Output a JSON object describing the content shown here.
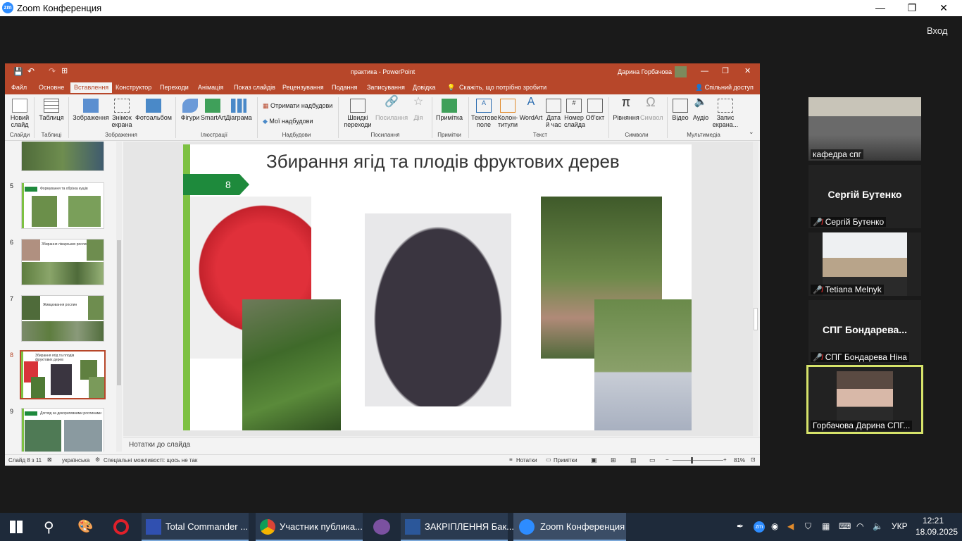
{
  "zoom": {
    "title": "Zoom Конференция",
    "logo": "zm",
    "exit_label": "Вход",
    "min": "—",
    "max": "❐",
    "close": "✕"
  },
  "ppt": {
    "title": "практика  -  PowerPoint",
    "user": "Дарина Горбачова",
    "tabs": [
      "Файл",
      "Основне",
      "Вставлення",
      "Конструктор",
      "Переходи",
      "Анімація",
      "Показ слайдів",
      "Рецензування",
      "Подання",
      "Записування",
      "Довідка"
    ],
    "tell_me": "Скажіть, що потрібно зробити",
    "share": "Спільний доступ",
    "ribbon": {
      "new_slide": "Новий слайд",
      "table": "Таблиця",
      "images": "Зображення",
      "screenshot": "Знімок екрана",
      "photoalbum": "Фотоальбом",
      "shapes": "Фігури",
      "smartart": "SmartArt",
      "chart": "Діаграма",
      "get_addins": "Отримати надбудови",
      "my_addins": "Мої надбудови",
      "quick_links": "Швидкі переходи",
      "link": "Посилання",
      "action": "Дія",
      "comment": "Примітка",
      "textbox": "Текстове поле",
      "header": "Колон-титули",
      "wordart": "WordArt",
      "datetime": "Дата й час",
      "slidenum": "Номер слайда",
      "object": "Об'єкт",
      "equation": "Рівняння",
      "symbol": "Символ",
      "video": "Відео",
      "audio": "Аудіо",
      "record": "Запис екрана...",
      "groups": [
        "Слайди",
        "Таблиці",
        "Зображення",
        "Ілюстрації",
        "Надбудови",
        "Посилання",
        "Примітки",
        "Текст",
        "Символи",
        "Мультимедіа"
      ]
    },
    "thumbs": [
      "5",
      "6",
      "7",
      "8",
      "9"
    ],
    "thumb_titles": {
      "t5": "Формування та обрізка кущів",
      "t6": "Збирання лікарських рослин",
      "t7": "Живцювання рослин",
      "t8": "Збирання ягід та плодів фруктових дерев",
      "t9": "Догляд за декоративними рослинами"
    },
    "slide": {
      "number": "8",
      "title": "Збирання ягід та плодів фруктових дерев"
    },
    "notes": "Нотатки до слайда",
    "status": {
      "slide": "Слайд 8 з 11",
      "lang": "українська",
      "access": "Спеціальні можливості: щось не так",
      "notes": "Нотатки",
      "comments": "Примітки",
      "zoom": "81%"
    }
  },
  "participants": [
    {
      "name": "кафедра спг",
      "muted": false,
      "video": true
    },
    {
      "name": "Сергій Бутенко",
      "display": "Сергій Бутенко",
      "muted": true,
      "video": false
    },
    {
      "name": "Tetiana Melnyk",
      "muted": true,
      "video": true
    },
    {
      "name": "СПГ Бондарева Ніна",
      "display": "СПГ  Бондарева...",
      "muted": true,
      "video": false
    },
    {
      "name": "Горбачова Дарина СПГ...",
      "muted": false,
      "video": true
    }
  ],
  "taskbar": {
    "apps": [
      "Total Commander ...",
      "Участник публика...",
      "ЗАКРІПЛЕННЯ Бак...",
      "Zoom Конференция"
    ],
    "lang": "УКР",
    "time": "12:21",
    "date": "18.09.2025"
  },
  "colors": {
    "ppt_accent": "#b7472a",
    "slide_green": "#1e8a3c",
    "zoom_blue": "#2d8cff"
  }
}
